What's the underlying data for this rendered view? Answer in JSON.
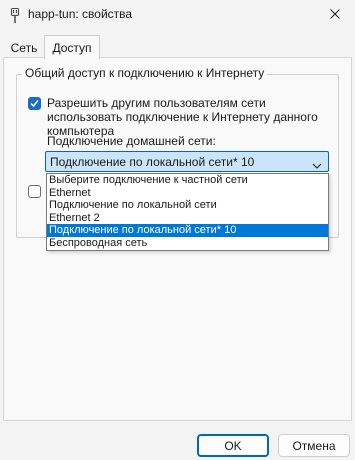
{
  "window": {
    "title": "happ-tun: свойства",
    "app_icon": "plug-icon",
    "close_icon": "close-icon"
  },
  "tabs": [
    {
      "label": "Сеть",
      "active": false
    },
    {
      "label": "Доступ",
      "active": true
    }
  ],
  "sharing": {
    "group_title": "Общий доступ к подключению к Интернету",
    "allow_checkbox": {
      "checked": true,
      "label": "Разрешить другим пользователям сети использовать подключение к Интернету данного компьютера"
    },
    "home_network_label": "Подключение домашней сети:",
    "combo_value": "Подключение по локальной сети* 10",
    "options": [
      "Выберите подключение к частной сети",
      "Ethernet",
      "Подключение по локальной сети",
      "Ethernet 2",
      "Подключение по локальной сети* 10",
      "Беспроводная сеть"
    ],
    "selected_option_index": 4,
    "second_checkbox": {
      "checked": false
    }
  },
  "buttons": {
    "ok": "OK",
    "cancel": "Отмена"
  },
  "colors": {
    "accent": "#0067c0",
    "selection": "#0078d7",
    "combo_bg": "#cce4f7"
  }
}
